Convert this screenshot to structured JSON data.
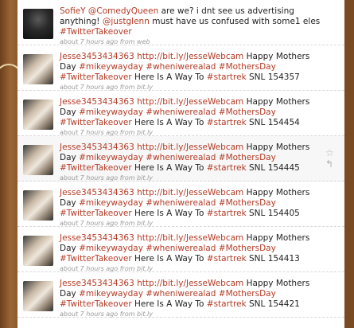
{
  "tweets": [
    {
      "user": "SofieY",
      "mention1": "@ComedyQueen",
      "text1": " are we? i dnt see us advertising anything! ",
      "mention2": "@justglenn",
      "text2": " must have us confused with some1 eles ",
      "tag1": "#TwitterTakeover",
      "meta": "about 7 hours ago from web"
    },
    {
      "user": "Jesse3453434363",
      "url": "http://bit.ly/JesseWebcam",
      "text1": " Happy Mothers Day ",
      "tag1": "#mikeywayday",
      "tag2": "#wheniwerealad",
      "tag3": "#MothersDay",
      "tag4": "#TwitterTakeover",
      "text2": " Here Is A Way To ",
      "tag5": "#startrek",
      "text3": " SNL 154357",
      "meta": "about 7 hours ago from bit.ly"
    },
    {
      "user": "Jesse3453434363",
      "url": "http://bit.ly/JesseWebcam",
      "text1": " Happy Mothers Day ",
      "tag1": "#mikeywayday",
      "tag2": "#wheniwerealad",
      "tag3": "#MothersDay",
      "tag4": "#TwitterTakeover",
      "text2": " Here Is A Way To ",
      "tag5": "#startrek",
      "text3": " SNL 154454",
      "meta": "about 7 hours ago from bit.ly"
    },
    {
      "user": "Jesse3453434363",
      "url": "http://bit.ly/JesseWebcam",
      "text1": " Happy Mothers Day ",
      "tag1": "#mikeywayday",
      "tag2": "#wheniwerealad",
      "tag3": "#MothersDay",
      "tag4": "#TwitterTakeover",
      "text2": " Here Is A Way To ",
      "tag5": "#startrek",
      "text3": " SNL 154445",
      "meta": "about 7 hours ago from bit.ly"
    },
    {
      "user": "Jesse3453434363",
      "url": "http://bit.ly/JesseWebcam",
      "text1": " Happy Mothers Day ",
      "tag1": "#mikeywayday",
      "tag2": "#wheniwerealad",
      "tag3": "#MothersDay",
      "tag4": "#TwitterTakeover",
      "text2": " Here Is A Way To ",
      "tag5": "#startrek",
      "text3": " SNL 154405",
      "meta": "about 7 hours ago from bit.ly"
    },
    {
      "user": "Jesse3453434363",
      "url": "http://bit.ly/JesseWebcam",
      "text1": " Happy Mothers Day ",
      "tag1": "#mikeywayday",
      "tag2": "#wheniwerealad",
      "tag3": "#MothersDay",
      "tag4": "#TwitterTakeover",
      "text2": " Here Is A Way To ",
      "tag5": "#startrek",
      "text3": " SNL 154413",
      "meta": "about 7 hours ago from bit.ly"
    },
    {
      "user": "Jesse3453434363",
      "url": "http://bit.ly/JesseWebcam",
      "text1": " Happy Mothers Day ",
      "tag1": "#mikeywayday",
      "tag2": "#wheniwerealad",
      "tag3": "#MothersDay",
      "tag4": "#TwitterTakeover",
      "text2": " Here Is A Way To ",
      "tag5": "#startrek",
      "text3": " SNL 154421",
      "meta": "about 7 hours ago from bit.ly"
    }
  ],
  "actions": {
    "favorite_icon": "☆",
    "reply_icon": "↰"
  },
  "colors": {
    "link": "#b43b26",
    "background": "#8a5a2e"
  }
}
